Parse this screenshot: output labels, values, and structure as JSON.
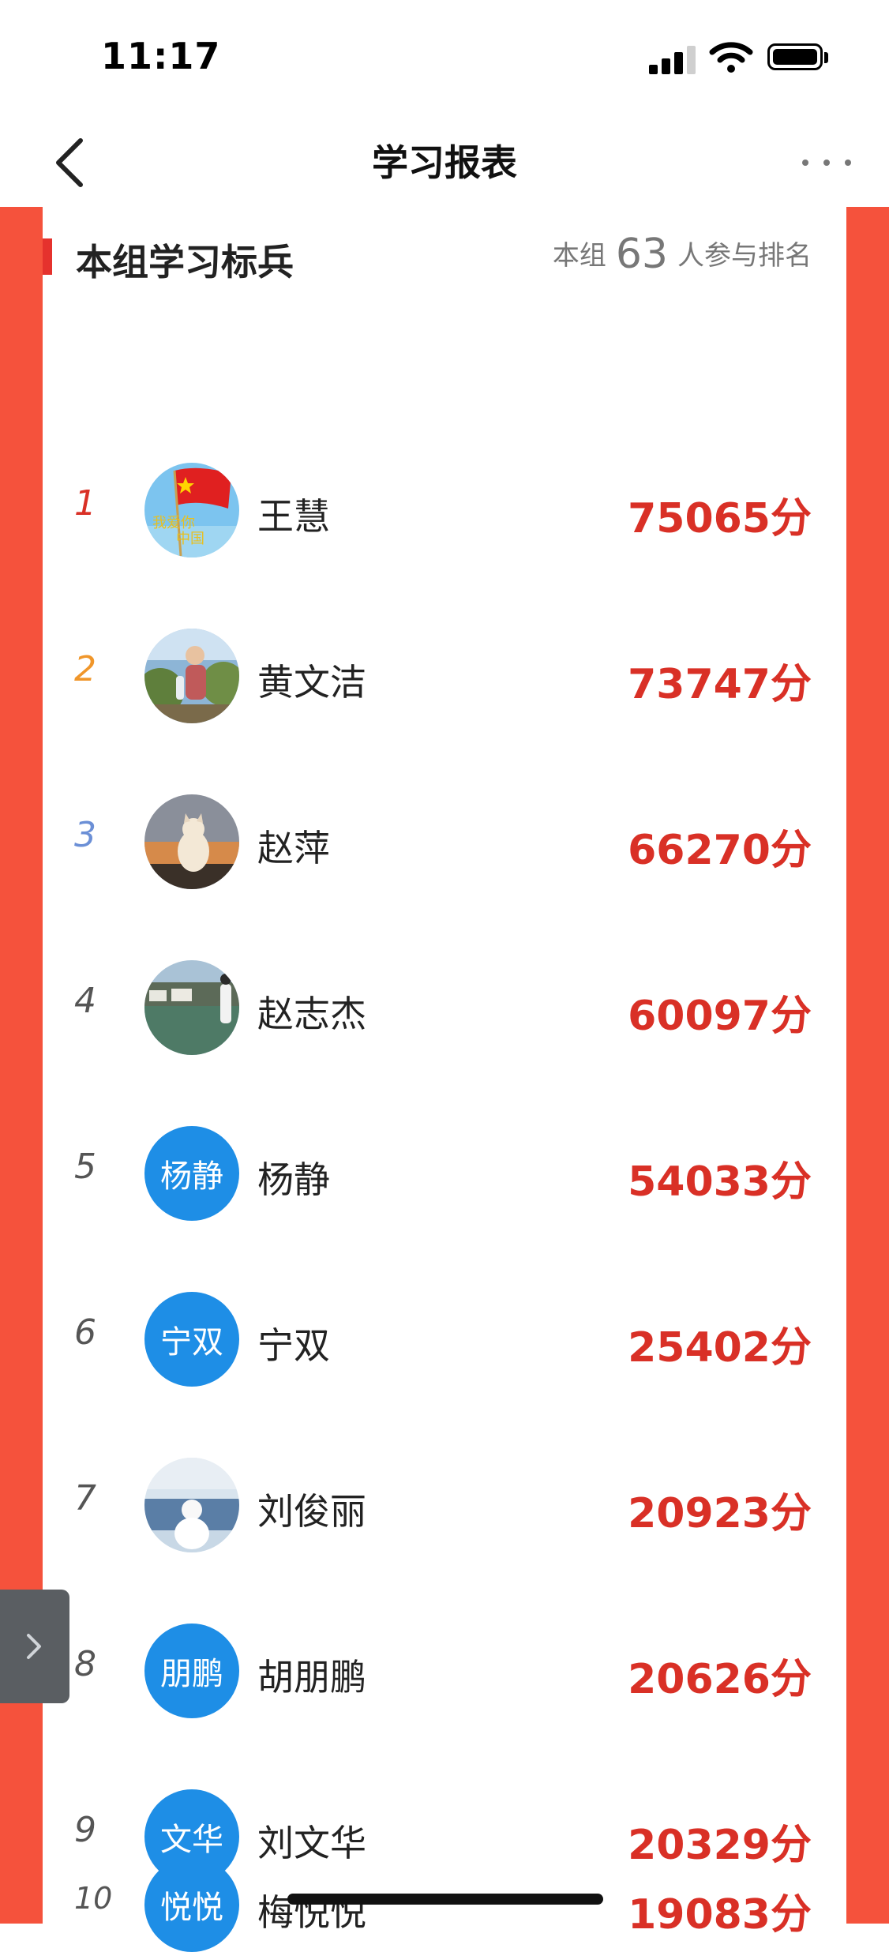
{
  "status_bar": {
    "time": "11:17"
  },
  "nav": {
    "title": "学习报表"
  },
  "card": {
    "title": "本组学习标兵",
    "participants_prefix": "本组",
    "participants_count": "63",
    "participants_suffix": "人参与排名"
  },
  "colors": {
    "accent_red": "#f5523c",
    "score_red": "#d93026",
    "avatar_blue": "#1e8ee6",
    "rank1": "#d93026",
    "rank2": "#f0962a",
    "rank3": "#6b8fd6"
  },
  "ranking": [
    {
      "rank": "1",
      "name": "王慧",
      "score": "75065分",
      "avatar": "flag-avatar"
    },
    {
      "rank": "2",
      "name": "黄文洁",
      "score": "73747分",
      "avatar": "photo-avatar-person"
    },
    {
      "rank": "3",
      "name": "赵萍",
      "score": "66270分",
      "avatar": "photo-avatar-cat-sunset"
    },
    {
      "rank": "4",
      "name": "赵志杰",
      "score": "60097分",
      "avatar": "photo-avatar-lake"
    },
    {
      "rank": "5",
      "name": "杨静",
      "score": "54033分",
      "avatar_text": "杨静"
    },
    {
      "rank": "6",
      "name": "宁双",
      "score": "25402分",
      "avatar_text": "宁双"
    },
    {
      "rank": "7",
      "name": "刘俊丽",
      "score": "20923分",
      "avatar": "photo-avatar-snowman"
    },
    {
      "rank": "8",
      "name": "胡朋鹏",
      "score": "20626分",
      "avatar_text": "朋鹏"
    },
    {
      "rank": "9",
      "name": "刘文华",
      "score": "20329分",
      "avatar_text": "文华"
    },
    {
      "rank": "10",
      "name": "梅悦悦",
      "score": "19083分",
      "avatar_text": "悦悦"
    }
  ]
}
